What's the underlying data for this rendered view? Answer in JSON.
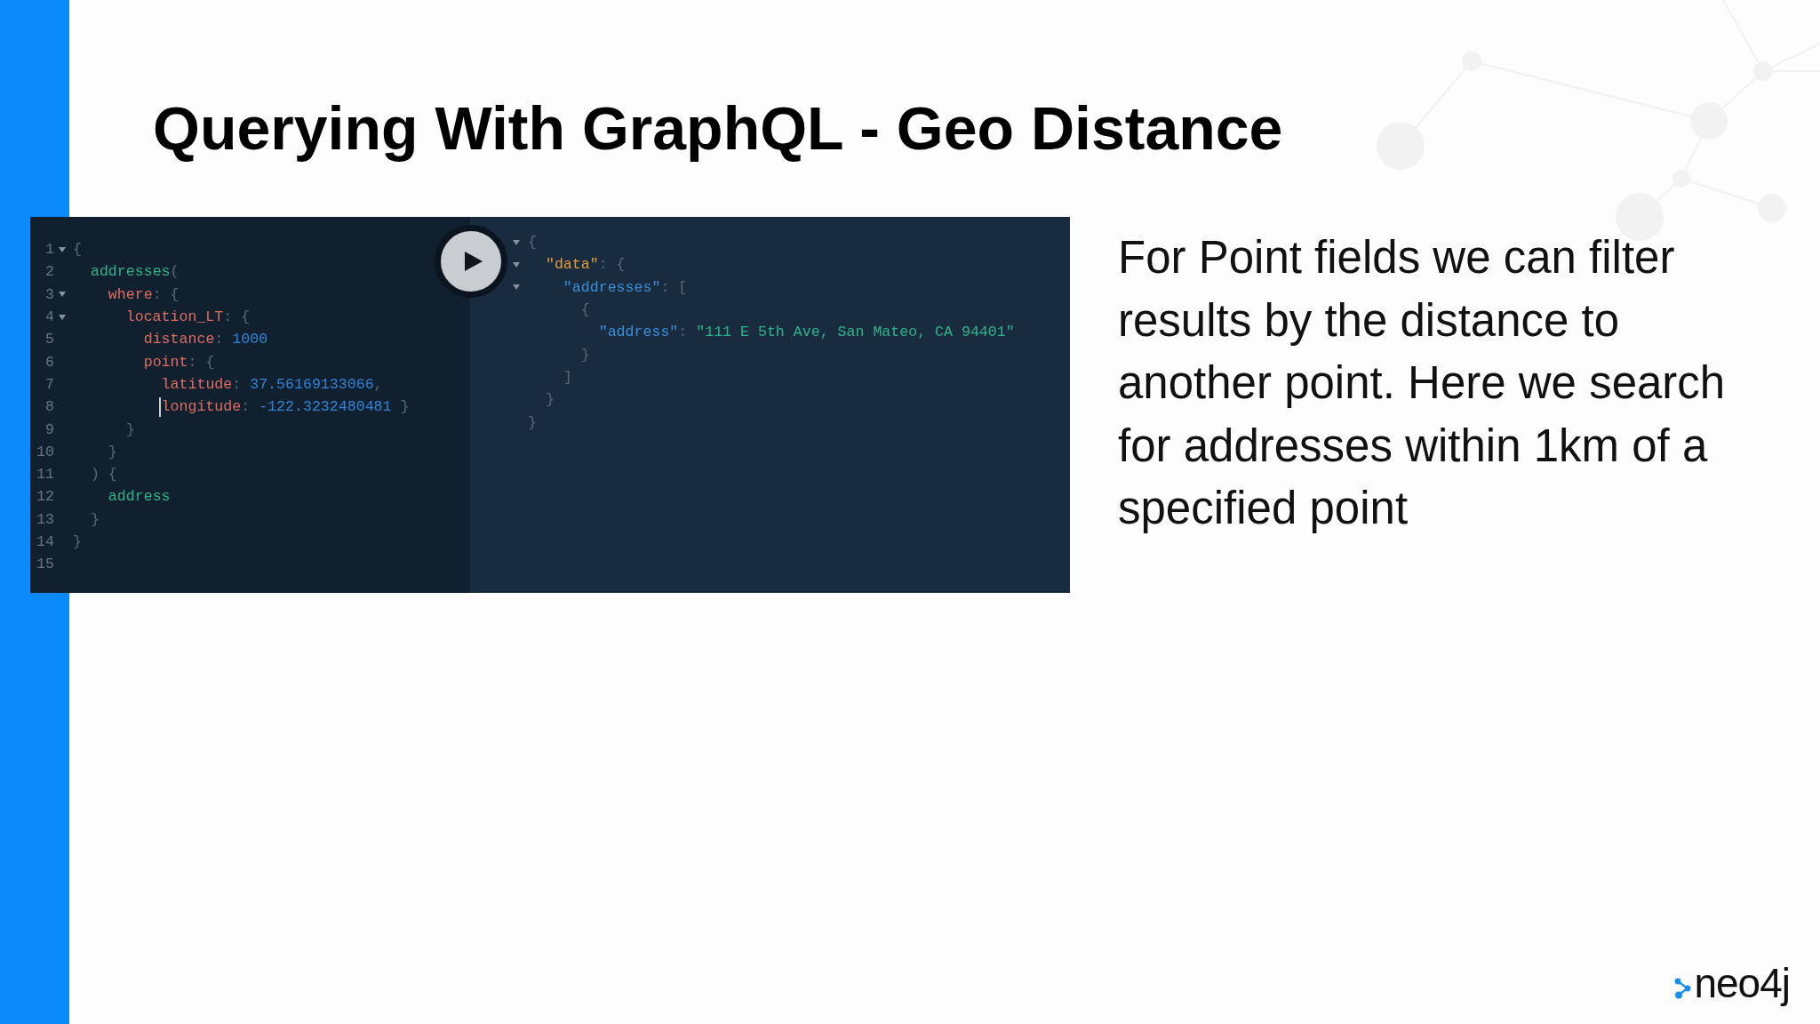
{
  "title": "Querying With GraphQL - Geo Distance",
  "query_editor": {
    "lines": [
      {
        "number": "1",
        "foldable": true,
        "cursor": false,
        "tokens": [
          {
            "kind": "punct",
            "text": "{"
          }
        ]
      },
      {
        "number": "2",
        "foldable": false,
        "cursor": false,
        "tokens": [
          {
            "kind": "field",
            "text": "  addresses"
          },
          {
            "kind": "punct",
            "text": "("
          }
        ]
      },
      {
        "number": "3",
        "foldable": true,
        "cursor": false,
        "tokens": [
          {
            "kind": "argument",
            "text": "    where"
          },
          {
            "kind": "punct",
            "text": ": {"
          }
        ]
      },
      {
        "number": "4",
        "foldable": true,
        "cursor": false,
        "tokens": [
          {
            "kind": "argument",
            "text": "      location_LT"
          },
          {
            "kind": "punct",
            "text": ": {"
          }
        ]
      },
      {
        "number": "5",
        "foldable": false,
        "cursor": false,
        "tokens": [
          {
            "kind": "argument",
            "text": "        distance"
          },
          {
            "kind": "punct",
            "text": ": "
          },
          {
            "kind": "number",
            "text": "1000"
          }
        ]
      },
      {
        "number": "6",
        "foldable": false,
        "cursor": false,
        "tokens": [
          {
            "kind": "argument",
            "text": "        point"
          },
          {
            "kind": "punct",
            "text": ": {"
          }
        ]
      },
      {
        "number": "7",
        "foldable": false,
        "cursor": false,
        "tokens": [
          {
            "kind": "argument",
            "text": "          latitude"
          },
          {
            "kind": "punct",
            "text": ": "
          },
          {
            "kind": "number",
            "text": "37.56169133066"
          },
          {
            "kind": "punct",
            "text": ","
          }
        ]
      },
      {
        "number": "8",
        "foldable": false,
        "cursor": true,
        "tokens": [
          {
            "kind": "argument",
            "text": "          longitude"
          },
          {
            "kind": "punct",
            "text": ": "
          },
          {
            "kind": "number",
            "text": "-122.3232480481"
          },
          {
            "kind": "punct",
            "text": " }"
          }
        ]
      },
      {
        "number": "9",
        "foldable": false,
        "cursor": false,
        "tokens": [
          {
            "kind": "punct",
            "text": "      }"
          }
        ]
      },
      {
        "number": "10",
        "foldable": false,
        "cursor": false,
        "tokens": [
          {
            "kind": "punct",
            "text": "    }"
          }
        ]
      },
      {
        "number": "11",
        "foldable": false,
        "cursor": false,
        "tokens": [
          {
            "kind": "punct",
            "text": "  ) {"
          }
        ]
      },
      {
        "number": "12",
        "foldable": false,
        "cursor": false,
        "tokens": [
          {
            "kind": "field",
            "text": "    address"
          }
        ]
      },
      {
        "number": "13",
        "foldable": false,
        "cursor": false,
        "tokens": [
          {
            "kind": "punct",
            "text": "  }"
          }
        ]
      },
      {
        "number": "14",
        "foldable": false,
        "cursor": false,
        "tokens": [
          {
            "kind": "punct",
            "text": "}"
          }
        ]
      },
      {
        "number": "15",
        "foldable": false,
        "cursor": false
      }
    ]
  },
  "result_viewer": {
    "lines": [
      {
        "foldable": true,
        "tokens": [
          {
            "kind": "punct",
            "text": "{"
          }
        ]
      },
      {
        "foldable": true,
        "tokens": [
          {
            "kind": "root_key",
            "text": "  \"data\""
          },
          {
            "kind": "punct",
            "text": ": {"
          }
        ]
      },
      {
        "foldable": true,
        "tokens": [
          {
            "kind": "key",
            "text": "    \"addresses\""
          },
          {
            "kind": "punct",
            "text": ": ["
          }
        ]
      },
      {
        "foldable": false,
        "tokens": [
          {
            "kind": "punct",
            "text": "      {"
          }
        ]
      },
      {
        "foldable": false,
        "tokens": [
          {
            "kind": "key",
            "text": "        \"address\""
          },
          {
            "kind": "punct",
            "text": ": "
          },
          {
            "kind": "string",
            "text": "\"111 E 5th Ave, San Mateo, CA 94401\""
          }
        ]
      },
      {
        "foldable": false,
        "tokens": [
          {
            "kind": "punct",
            "text": "      }"
          }
        ]
      },
      {
        "foldable": false,
        "tokens": [
          {
            "kind": "punct",
            "text": "    ]"
          }
        ]
      },
      {
        "foldable": false,
        "tokens": [
          {
            "kind": "punct",
            "text": "  }"
          }
        ]
      },
      {
        "foldable": false,
        "tokens": [
          {
            "kind": "punct",
            "text": "}"
          }
        ]
      }
    ]
  },
  "description": "For Point fields we can filter results by the distance to another point. Here we search for addresses within 1km of a specified point",
  "logo": {
    "wordmark": "neo4j"
  }
}
